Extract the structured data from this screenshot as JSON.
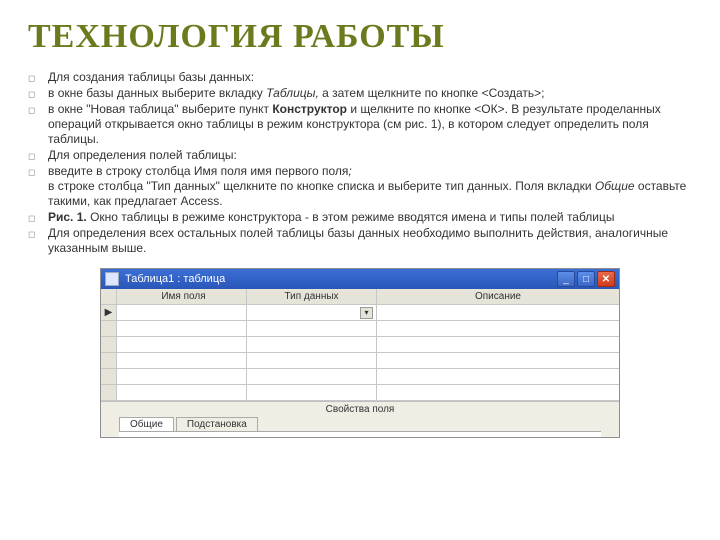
{
  "heading": "ТЕХНОЛОГИЯ РАБОТЫ",
  "bullets": [
    {
      "html": "Для создания таблицы базы данных:"
    },
    {
      "html": "в окне базы данных выберите вкладку <em>Таблицы,</em>  а затем щелкните по кнопке &lt;Создать&gt;;"
    },
    {
      "html": "в окне \"Новая таблица\" выберите пункт <strong>Конструктор</strong> и щелкните по кнопке &lt;ОК&gt;. В результате проделанных операций открывается окно таблицы в режим конструктора (см рис. 1), в котором следует определить поля таблицы."
    },
    {
      "html": "Для определения полей таблицы:"
    },
    {
      "html": "введите в строку столбца Имя поля имя первого поля<em>;</em><br>в строке столбца \"Тип данных\" щелкните по кнопке списка и выберите тип данных. Поля вкладки <em>Общие</em> оставьте такими, как предлагает Access."
    },
    {
      "html": "<strong>Рис. 1.</strong> Окно таблицы в режиме конструктора - в этом режиме вводятся имена и типы полей таблицы"
    },
    {
      "html": "Для определения всех остальных полей таблицы базы данных необходимо выполнить действия, аналогичные указанным выше."
    }
  ],
  "window": {
    "title": "Таблица1 : таблица",
    "min": "_",
    "max": "□",
    "close": "✕"
  },
  "grid": {
    "headers": {
      "col1": "Имя поля",
      "col2": "Тип данных",
      "col3": "Описание"
    },
    "cursor_marker": "▶",
    "dropdown_marker": "▾"
  },
  "field_props": {
    "caption": "Свойства поля",
    "tab1": "Общие",
    "tab2": "Подстановка"
  }
}
